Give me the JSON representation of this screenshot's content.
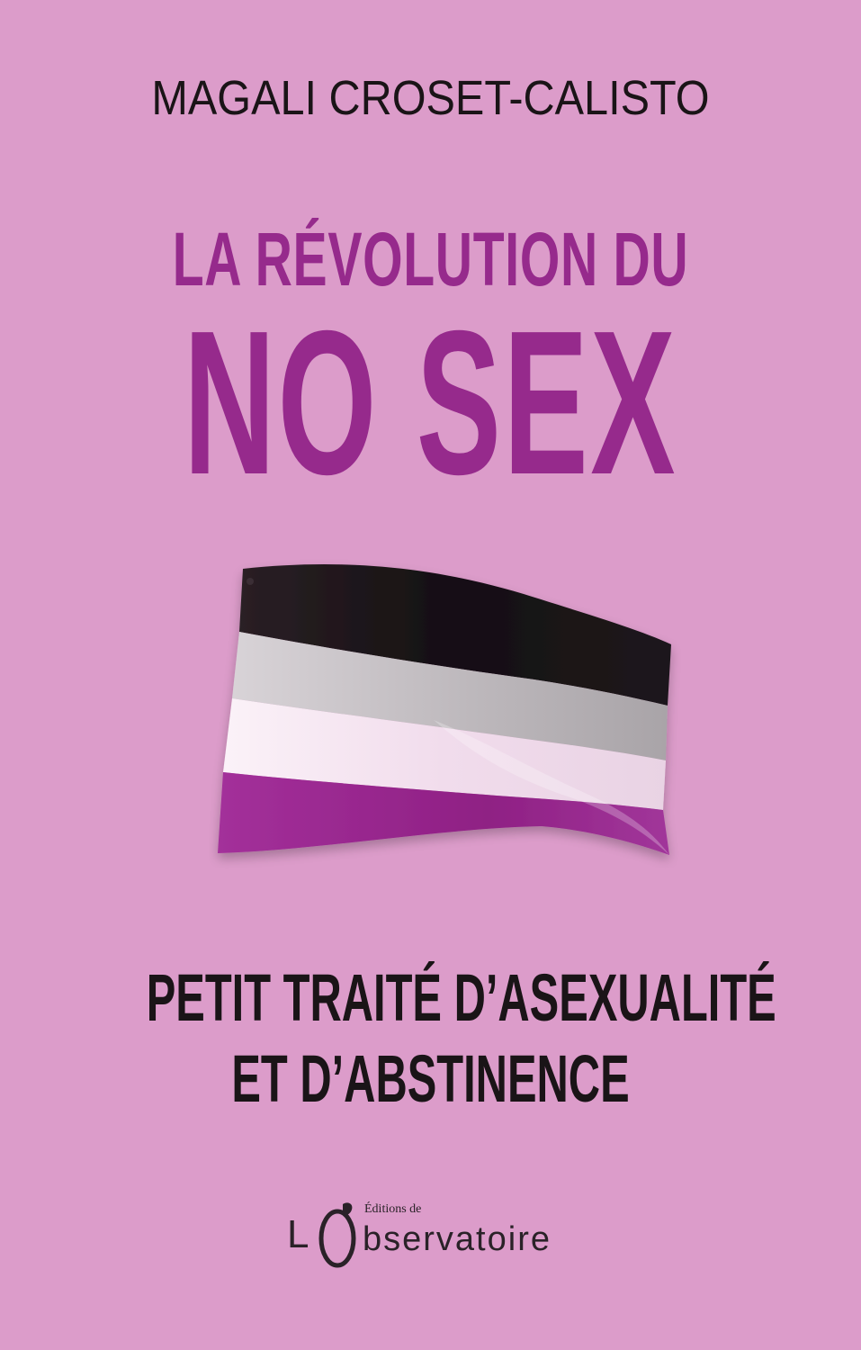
{
  "cover": {
    "author": "MAGALI CROSET-CALISTO",
    "title_line1": "LA RÉVOLUTION DU",
    "title_line2": "NO SEX",
    "subtitle_line1": "PETIT TRAITÉ D’ASEXUALITÉ",
    "subtitle_line2": "ET D’ABSTINENCE",
    "publisher": {
      "prefix": "Éditions de",
      "letter_L": "L",
      "name_rest": "bservatoire"
    },
    "colors": {
      "background": "#dc9cca",
      "title": "#962a8c",
      "text": "#1a1417",
      "flag_black": "#1c1418",
      "flag_gray": "#c9c4c8",
      "flag_white": "#f6e9f3",
      "flag_purple": "#9b2890"
    },
    "icons": {
      "flag": "asexual-pride-flag-icon",
      "publisher_logo": "observatoire-logo"
    }
  }
}
